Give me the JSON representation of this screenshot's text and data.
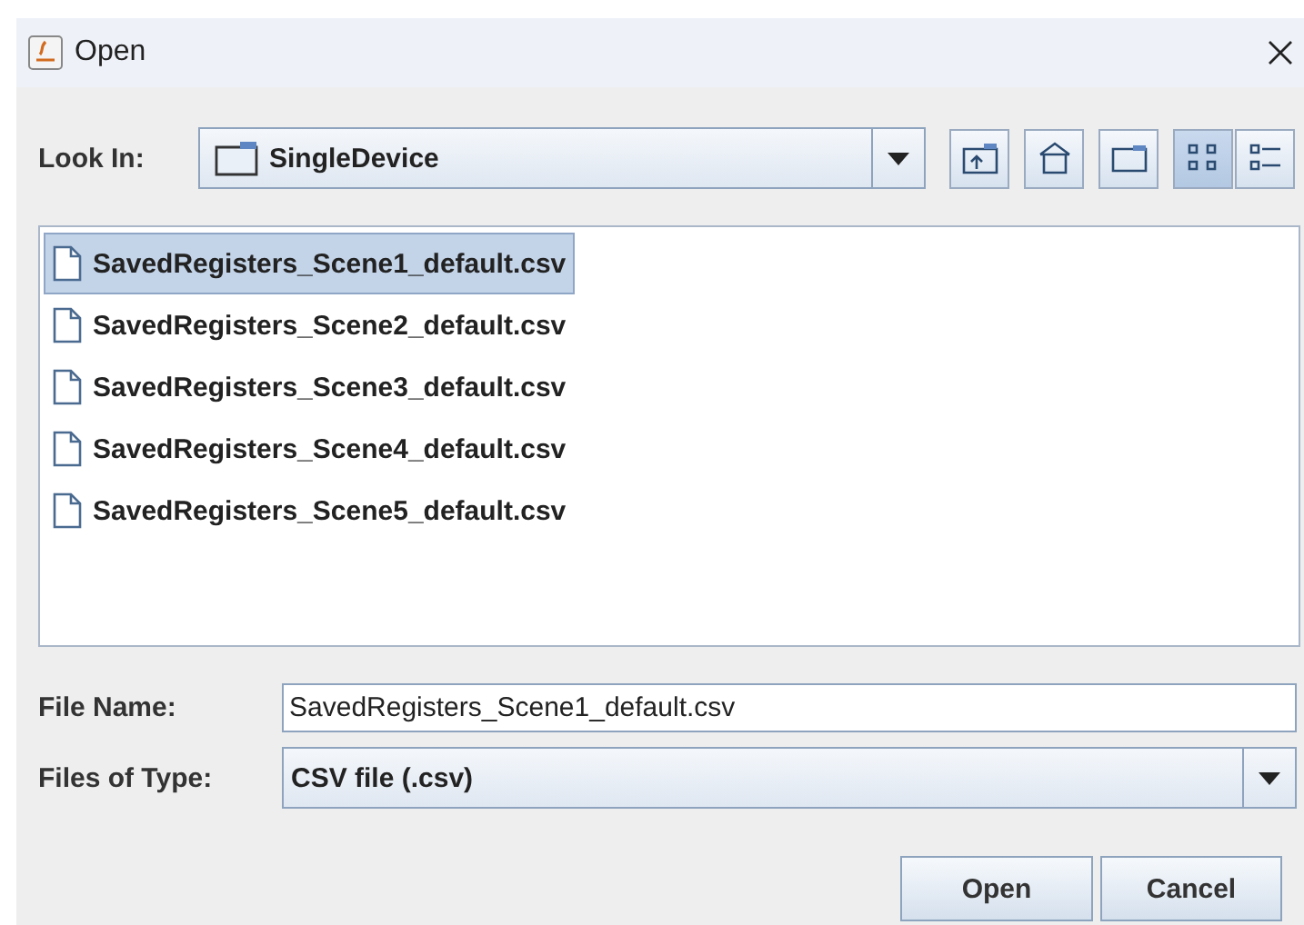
{
  "window": {
    "title": "Open"
  },
  "look_in": {
    "label": "Look In:",
    "value": "SingleDevice"
  },
  "toolbar": [
    {
      "kind": "up",
      "selected": false
    },
    {
      "kind": "home",
      "selected": false
    },
    {
      "kind": "new_folder",
      "selected": false
    },
    {
      "kind": "list",
      "selected": true
    },
    {
      "kind": "details",
      "selected": false
    }
  ],
  "files": [
    {
      "name": "SavedRegisters_Scene1_default.csv",
      "selected": true
    },
    {
      "name": "SavedRegisters_Scene2_default.csv",
      "selected": false
    },
    {
      "name": "SavedRegisters_Scene3_default.csv",
      "selected": false
    },
    {
      "name": "SavedRegisters_Scene4_default.csv",
      "selected": false
    },
    {
      "name": "SavedRegisters_Scene5_default.csv",
      "selected": false
    }
  ],
  "file_name": {
    "label": "File Name:",
    "value": "SavedRegisters_Scene1_default.csv"
  },
  "files_of_type": {
    "label": "Files of Type:",
    "value": "CSV file (.csv)"
  },
  "buttons": [
    "Open",
    "Cancel"
  ]
}
